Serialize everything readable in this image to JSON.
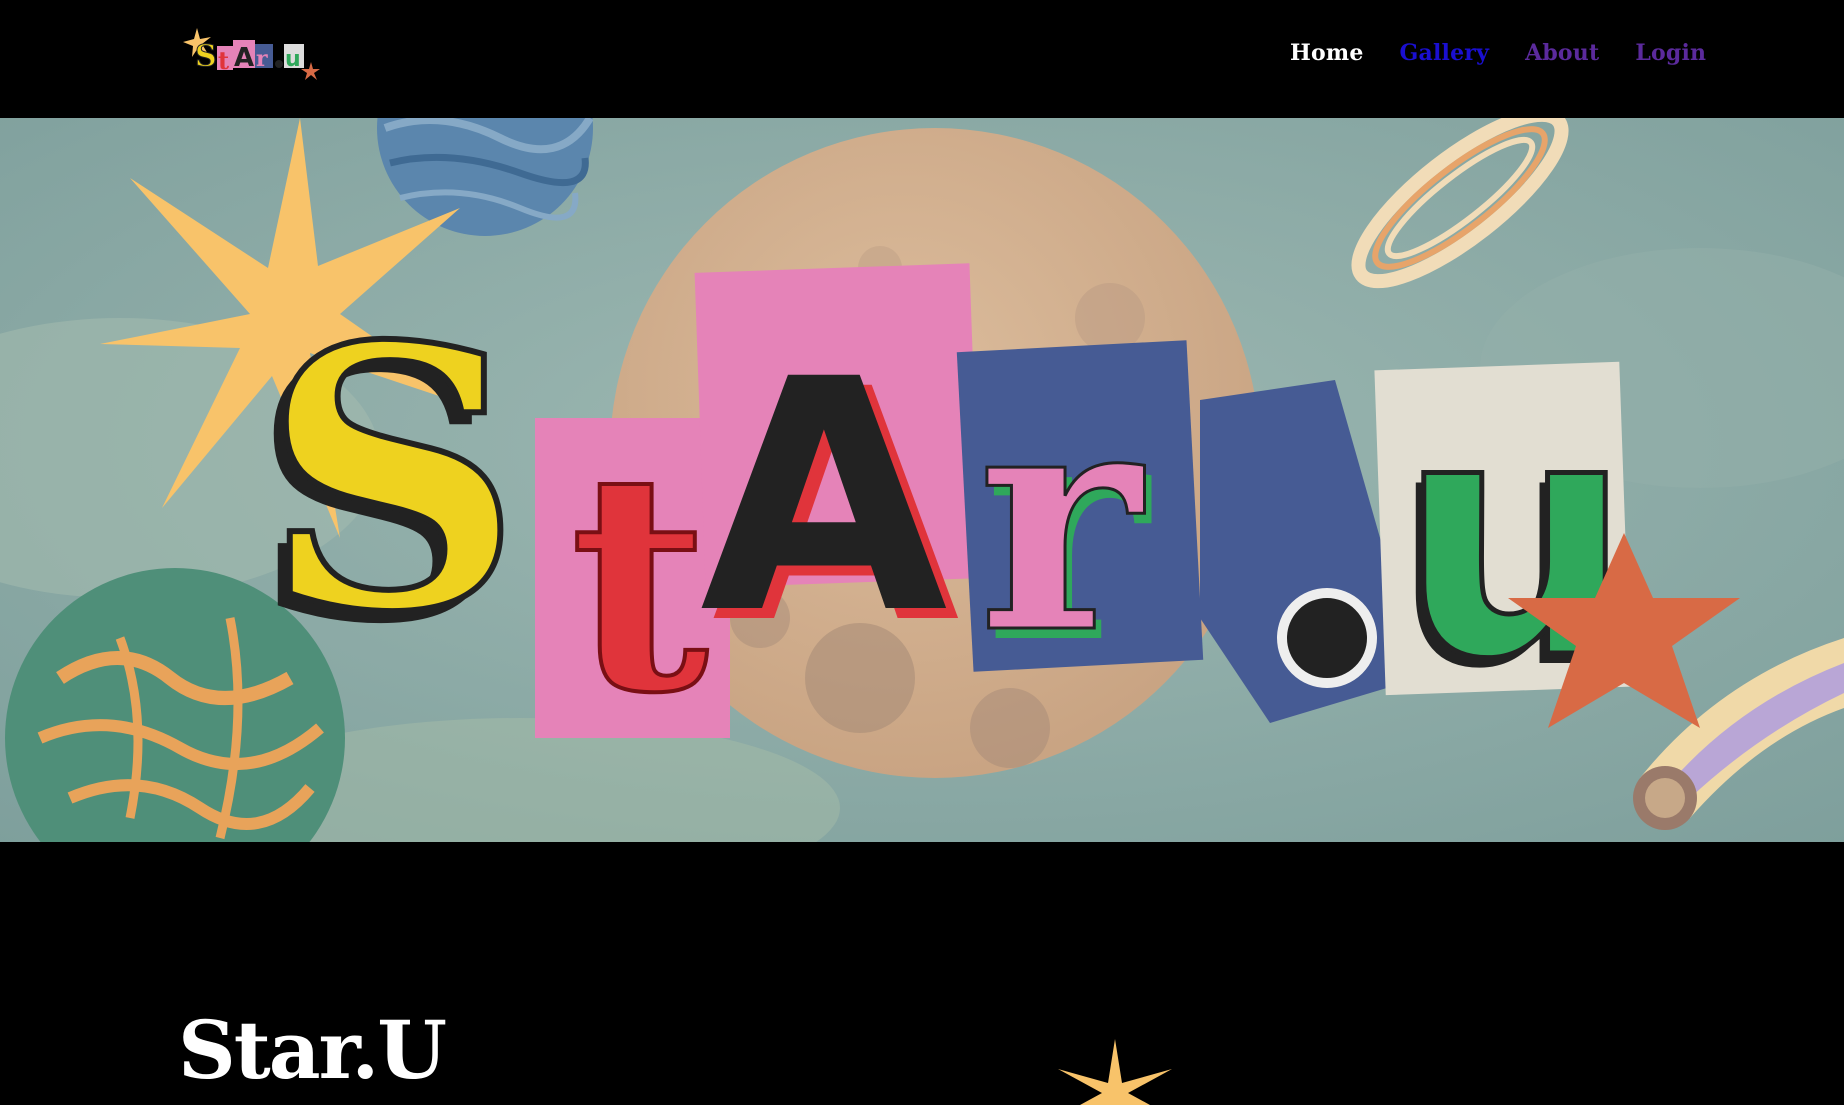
{
  "nav": {
    "links": [
      {
        "label": "Home",
        "color": "#ffffff"
      },
      {
        "label": "Gallery",
        "color": "#1a0fd0"
      },
      {
        "label": "About",
        "color": "#5b2a9c"
      },
      {
        "label": "Login",
        "color": "#5b2a9c"
      }
    ]
  },
  "logo": {
    "text": "Star.U",
    "icon": "star-u-collage-logo"
  },
  "hero": {
    "letters": [
      "S",
      "t",
      "A",
      "r",
      ".",
      "U"
    ],
    "icon": "space-collage-banner"
  },
  "content": {
    "title": "Star.U"
  },
  "colors": {
    "sky": "#8aa9a6",
    "moon": "#d6b393",
    "yellow": "#eed21f",
    "pink": "#e583b8",
    "red": "#e0343b",
    "navy": "#465b94",
    "green": "#2fa85b",
    "orange_star": "#d86a45",
    "yellow_star": "#f8c36a"
  }
}
